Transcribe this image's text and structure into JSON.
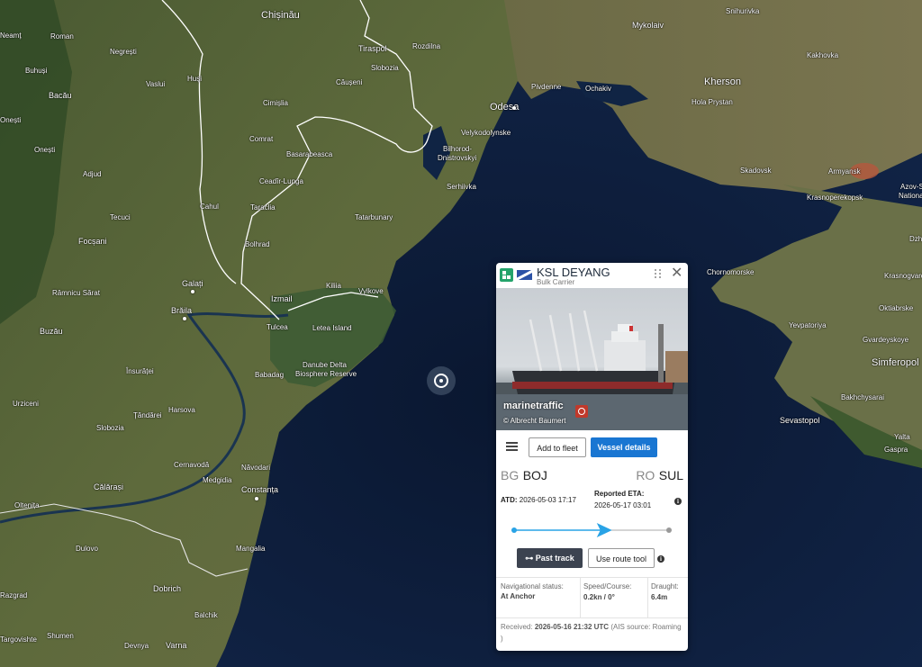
{
  "map": {
    "labels": {
      "chisinau": "Chișinău",
      "tiraspol": "Tiraspol",
      "rozdilna": "Rozdilna",
      "mykolaiv": "Mykolaiv",
      "snihurivka": "Snihurivka",
      "neamt": "Neamț",
      "roman": "Roman",
      "negresti": "Negrești",
      "buhusi": "Buhuși",
      "vaslui": "Vaslui",
      "husi": "Huși",
      "bacau": "Bacău",
      "onesti": "Onești",
      "adjud": "Adjud",
      "tecuci": "Tecuci",
      "focsani": "Focșani",
      "rm_sarat": "Râmnicu Sărat",
      "buzau": "Buzău",
      "braila": "Brăila",
      "galati": "Galați",
      "cahul": "Cahul",
      "bolhrad": "Bolhrad",
      "izmail": "Izmail",
      "kiliia": "Kiliia",
      "vylkove": "Vylkove",
      "tulcea": "Tulcea",
      "letea": "Letea Island",
      "danube1": "Danube Delta",
      "danube2": "Biosphere Reserve",
      "babadag": "Babadag",
      "harsova": "Harsova",
      "tandarei": "Țăndărei",
      "slobozia": "Slobozia",
      "urziceni": "Urziceni",
      "insuratei": "Însurăței",
      "cernavoda": "Cernavodă",
      "medgidia": "Medgidia",
      "navodari": "Năvodari",
      "constanta": "Constanța",
      "calarasi": "Călărași",
      "oltenita": "Oltenița",
      "dulovo": "Dulovo",
      "mangalia": "Mangalia",
      "dobrich": "Dobrich",
      "razgrad": "Razgrad",
      "balchik": "Balchik",
      "shumen": "Shumen",
      "targoviste": "Targovishte",
      "devnya": "Devnya",
      "varna": "Varna",
      "odesa": "Odesa",
      "pivdenne": "Pivdenne",
      "ochakiv": "Ochakiv",
      "vylkodolynske": "Velykodolynske",
      "bilhorod1": "Bilhorod-",
      "bilhorod2": "Dnistrovskyi",
      "serhiivka": "Serhiivka",
      "tatarbunary": "Tatarbunary",
      "slobozia_md": "Slobozia",
      "causeni": "Căușeni",
      "cimislia": "Cimișlia",
      "comrat": "Comrat",
      "basarabeasca": "Basarabeasca",
      "ceadir": "Ceadîr-Lunga",
      "taraclia": "Taraclia",
      "kherson": "Kherson",
      "hola": "Hola Prystan",
      "skadovsk": "Skadovsk",
      "kakhovka": "Kakhovka",
      "armyansk": "Armyansk",
      "krasnoperekopsk": "Krasnoperekopsk",
      "azov": "Azov-Sy",
      "nationa": "Nationa",
      "chornomorske": "Chornomorske",
      "yevpatoriya": "Yevpatoriya",
      "krasnogv": "Krasnogvarde",
      "oktiabrske": "Oktiabrske",
      "gvardeyskoye": "Gvardeyskoye",
      "simferopol": "Simferopol",
      "bakhchysarai": "Bakhchysarai",
      "sevastopol": "Sevastopol",
      "yalta": "Yalta",
      "gaspra": "Gaspra",
      "dzh": "Dzh",
      "ozhatnhu": "Onești"
    }
  },
  "panel": {
    "vessel_name": "KSL DEYANG",
    "vessel_type": "Bulk Carrier",
    "photo_watermark": "marinetraffic",
    "photo_credit": "© Albrecht Baumert",
    "add_to_fleet": "Add to fleet",
    "vessel_details": "Vessel details",
    "origin_country": "BG",
    "origin_port": "BOJ",
    "dest_country": "RO",
    "dest_port": "SUL",
    "atd_label": "ATD:",
    "atd_value": "2026-05-03 17:17",
    "eta_label": "Reported ETA:",
    "eta_value": "2026-05-17 03:01",
    "past_track": "Past track",
    "route_tool": "Use route tool",
    "nav_status_label": "Navigational status:",
    "nav_status_value": "At Anchor",
    "speed_label": "Speed/Course:",
    "speed_value": "0.2kn / 0°",
    "draught_label": "Draught:",
    "draught_value": "6.4m",
    "received_label": "Received:",
    "received_value": "2026-05-16 21:32 UTC",
    "ais_source": "(AIS source: Roaming )",
    "track_progress": 0.58
  },
  "colors": {
    "primary": "#1976d2",
    "track": "#29a3e6",
    "badge": "#24a36b",
    "sea": "#0c1a33"
  }
}
